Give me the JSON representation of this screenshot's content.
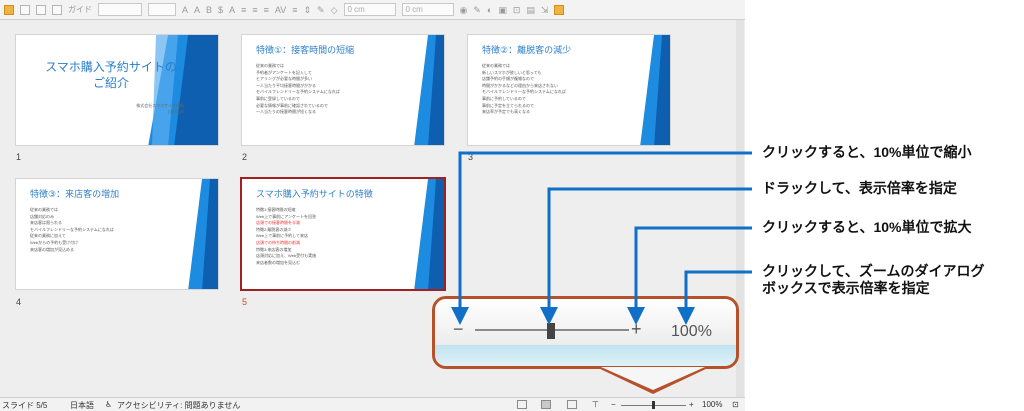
{
  "toolbar": {
    "font_style_label": "ガイド",
    "position_x": "0 cm",
    "position_y": "0 cm"
  },
  "slides": [
    {
      "number": "1",
      "title": "スマホ購入予約サイトの\nご紹介",
      "subtitle": "株式会社スマホサイズ技術\n山田次郎"
    },
    {
      "number": "2",
      "title": "特徴①：接客時間の短縮",
      "bullets": [
        "従来の業務では",
        "予約者がアンケートを記入して",
        "ヒアリングが必要な時間が多い",
        "一人当たり平均接客時間がかかる",
        "モバイルフレンドリーな予約システムになれば",
        "事前に登録しているので",
        "必要な情報が事前に確認されているので",
        "一人当たりの接客時間が短くなる"
      ]
    },
    {
      "number": "3",
      "title": "特徴②：離脱客の減少",
      "bullets": [
        "従来の業務では",
        "新しいスマホが欲しいと思っても",
        "店舗予約の手順が複雑なので",
        "時間がかかるなどの理由から来店されない",
        "モバイルフレンドリーな予約システムになれば",
        "事前に予約しているので",
        "事前に予定を立てられるので",
        "来店率が予定でも高くなる"
      ]
    },
    {
      "number": "4",
      "title": "特徴③：来店客の増加",
      "bullets": [
        "従来の業務では",
        "店舗対応のみ",
        "来店客は限られる",
        "モバイルフレンドリーな予約システムになれば",
        "従来の業務に加えて",
        "Webからの予約も受け付け",
        "来店客の増加が見込める"
      ]
    },
    {
      "number": "5",
      "title": "スマホ購入予約サイトの特徴",
      "bullets": [
        "特徴1:接客時間の短縮",
        "Web上で事前にアンケートを回答",
        "店頭での接客時間を半減",
        "特徴2:離脱客の減少",
        "Web上で事前に予約して来店",
        "店頭での待ち時間の削減",
        "特徴3:来店客の増加",
        "店頭対応に加え、Web受付も実施",
        "来店者数の増加を見込む"
      ],
      "selected": true
    }
  ],
  "statusbar": {
    "slide": "スライド 5/5",
    "language": "日本語",
    "accessibility": "アクセシビリティ: 問題ありません",
    "zoom": "100%"
  },
  "zoom_popup": {
    "minus": "−",
    "plus": "+",
    "percent": "100%"
  },
  "annotations": {
    "zoom_out": "クリックすると、10%単位で縮小",
    "drag": "ドラックして、表示倍率を指定",
    "zoom_in": "クリックすると、10%単位で拡大",
    "dialog_line1": "クリックして、ズームのダイアログ",
    "dialog_line2": "ボックスで表示倍率を指定"
  },
  "colors": {
    "accent_blue": "#1070c8",
    "popup_border": "#b7512a",
    "selected_border": "#a32020",
    "title_blue": "#2d7fcb"
  }
}
